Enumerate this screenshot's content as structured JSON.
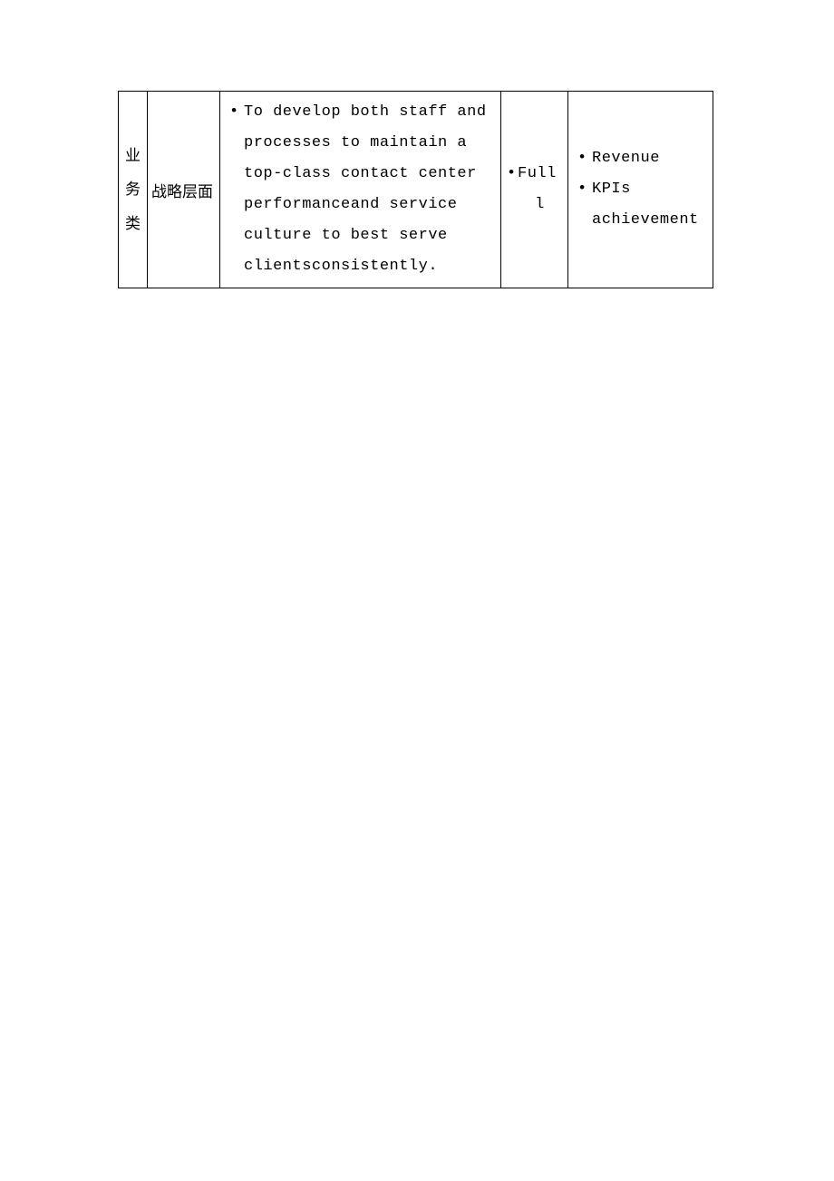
{
  "table": {
    "row1": {
      "col1_chars": [
        "业",
        "务",
        "类"
      ],
      "col2": "战略层面",
      "col3_items": [
        "To develop both staff and processes to maintain a top-class contact center performanceand service culture to best serve clientsconsistently."
      ],
      "col4_item": "Full",
      "col4_line2": "l",
      "col5_items": [
        "Revenue",
        "KPIs achievement"
      ]
    }
  }
}
